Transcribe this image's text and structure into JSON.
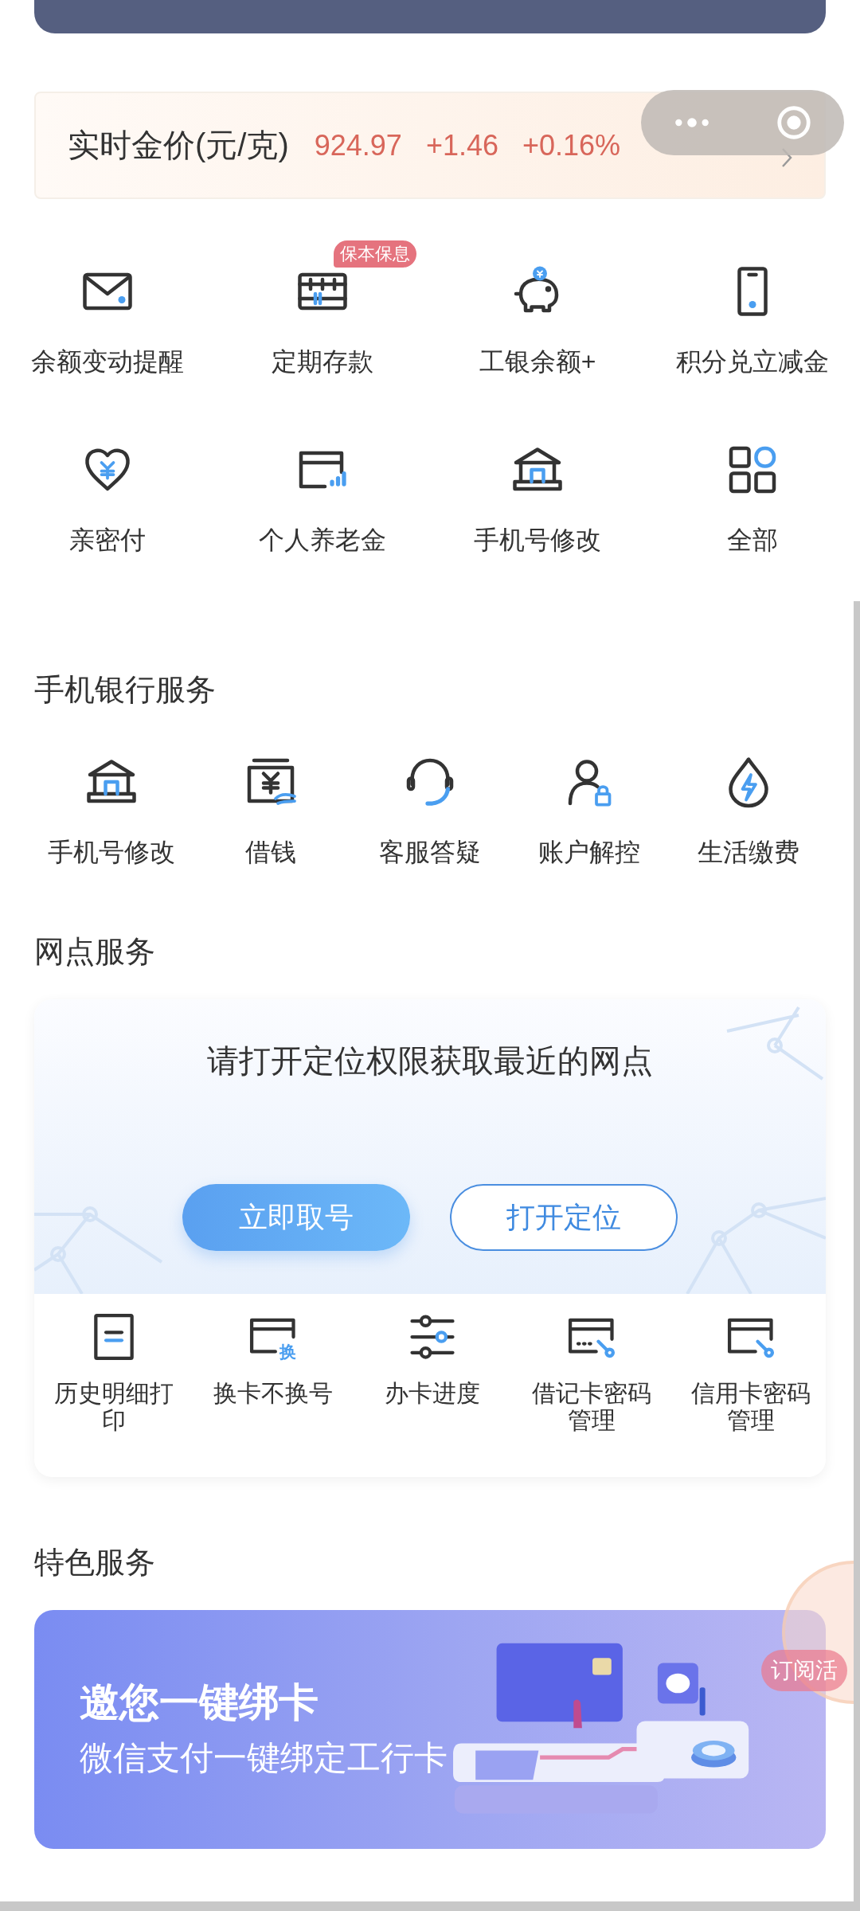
{
  "gold_price": {
    "label": "实时金价(元/克)",
    "price": "924.97",
    "change": "+1.46",
    "change_percent": "+0.16%"
  },
  "quick_grid": [
    {
      "label": "余额变动提醒",
      "kind": "envelope"
    },
    {
      "label": "定期存款",
      "kind": "abacus",
      "badge": "保本保息"
    },
    {
      "label": "工银余额+",
      "kind": "piggy"
    },
    {
      "label": "积分兑立减金",
      "kind": "phone"
    },
    {
      "label": "亲密付",
      "kind": "heart"
    },
    {
      "label": "个人养老金",
      "kind": "card-chart"
    },
    {
      "label": "手机号修改",
      "kind": "bank"
    },
    {
      "label": "全部",
      "kind": "apps"
    }
  ],
  "mobile_banking": {
    "title": "手机银行服务",
    "items": [
      {
        "label": "手机号修改",
        "kind": "bank"
      },
      {
        "label": "借钱",
        "kind": "cash"
      },
      {
        "label": "客服答疑",
        "kind": "headset"
      },
      {
        "label": "账户解控",
        "kind": "user-lock"
      },
      {
        "label": "生活缴费",
        "kind": "drop"
      }
    ]
  },
  "branch_service": {
    "title": "网点服务",
    "prompt": "请打开定位权限获取最近的网点",
    "buttons": [
      {
        "label": "立即取号",
        "kind": "primary"
      },
      {
        "label": "打开定位",
        "kind": "outline"
      }
    ],
    "items": [
      {
        "label": "历史明细打印",
        "kind": "document"
      },
      {
        "label": "换卡不换号",
        "kind": "card-text",
        "icon_text": "换"
      },
      {
        "label": "办卡进度",
        "kind": "sliders"
      },
      {
        "label": "借记卡密码管理",
        "kind": "card-key-dots"
      },
      {
        "label": "信用卡密码管理",
        "kind": "card-key"
      }
    ]
  },
  "featured": {
    "title": "特色服务",
    "banner_title": "邀您一键绑卡",
    "banner_subtitle": "微信支付一键绑定工行卡"
  },
  "floating_badge": "订阅活"
}
